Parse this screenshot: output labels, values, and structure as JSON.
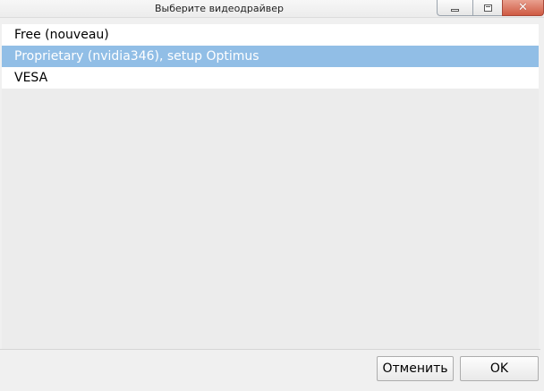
{
  "window": {
    "title": "Выберите видеодрайвер"
  },
  "titlebar_buttons": {
    "minimize_icon": "minimize-icon",
    "maximize_icon": "maximize-icon",
    "close_icon": "close-icon",
    "close_glyph": "✕"
  },
  "driver_list": {
    "selected_index": 1,
    "items": [
      {
        "label": "Free (nouveau)"
      },
      {
        "label": "Proprietary (nvidia346), setup Optimus"
      },
      {
        "label": "VESA"
      }
    ]
  },
  "buttons": {
    "cancel_label": "Отменить",
    "ok_label": "OK"
  },
  "colors": {
    "selection": "#91bee6",
    "close_button": "#cf5a42",
    "background": "#f0f0f0"
  }
}
